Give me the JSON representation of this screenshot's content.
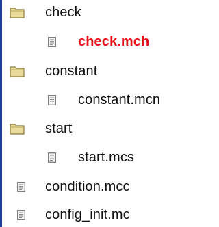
{
  "tree": {
    "items": [
      {
        "type": "folder",
        "label": "check",
        "icon": "folder-icon"
      },
      {
        "type": "file",
        "label": "check.mch",
        "icon": "file-icon",
        "highlight_color": "#e8101a"
      },
      {
        "type": "folder",
        "label": "constant",
        "icon": "folder-icon"
      },
      {
        "type": "file",
        "label": "constant.mcn",
        "icon": "file-icon"
      },
      {
        "type": "folder",
        "label": "start",
        "icon": "folder-icon"
      },
      {
        "type": "file",
        "label": "start.mcs",
        "icon": "file-icon"
      },
      {
        "type": "file",
        "label": "condition.mcc",
        "icon": "file-icon"
      },
      {
        "type": "file",
        "label": "config_init.mc",
        "icon": "file-icon"
      }
    ]
  },
  "colors": {
    "accent_bar": "#1f3f9a",
    "folder_fill": "#e9dc9c",
    "folder_stroke": "#8a7a3a",
    "text": "#111111",
    "highlight_text": "#e8101a"
  }
}
